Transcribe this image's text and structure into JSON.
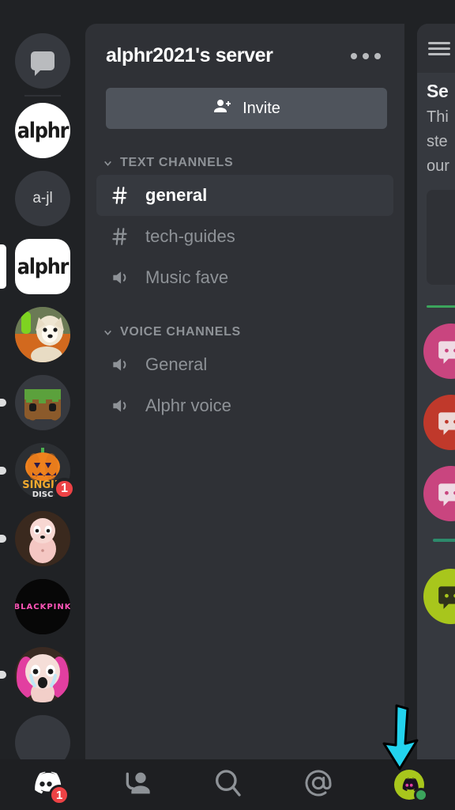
{
  "server_rail": {
    "items": [
      {
        "name": "direct-messages",
        "type": "dm-home",
        "label": "",
        "indicator": "none",
        "badge": ""
      },
      {
        "name": "server-alphr-circle",
        "type": "wordmark-circle",
        "label": "alphr",
        "indicator": "none",
        "badge": ""
      },
      {
        "name": "server-a-jl",
        "type": "text-circle",
        "label": "a-jl",
        "indicator": "none",
        "badge": ""
      },
      {
        "name": "server-alphr-active",
        "type": "wordmark-square",
        "label": "alphr",
        "indicator": "active",
        "badge": ""
      },
      {
        "name": "server-dog",
        "type": "art-dog",
        "label": "",
        "indicator": "none",
        "badge": ""
      },
      {
        "name": "server-minecraft",
        "type": "art-minecraft",
        "label": "",
        "indicator": "dot",
        "badge": ""
      },
      {
        "name": "server-singin-disc",
        "type": "art-pumpkin",
        "label": "SINGIN' DISC",
        "indicator": "dot",
        "badge": "1"
      },
      {
        "name": "server-isaac",
        "type": "art-isaac",
        "label": "",
        "indicator": "dot",
        "badge": ""
      },
      {
        "name": "server-blackpink",
        "type": "art-blackpink",
        "label": "BLACKPINK",
        "indicator": "none",
        "badge": ""
      },
      {
        "name": "server-isaac-crying",
        "type": "art-isaac-cry",
        "label": "",
        "indicator": "dot",
        "badge": ""
      },
      {
        "name": "add-server",
        "type": "add",
        "label": "",
        "indicator": "none",
        "badge": ""
      }
    ]
  },
  "panel": {
    "server_name": "alphr2021's server",
    "overflow_label": "More options",
    "invite_label": "Invite",
    "categories": [
      {
        "name": "TEXT CHANNELS",
        "channels": [
          {
            "label": "general",
            "icon": "hash-icon",
            "selected": true
          },
          {
            "label": "tech-guides",
            "icon": "hash-icon",
            "selected": false
          },
          {
            "label": "Music fave",
            "icon": "speaker-icon",
            "selected": false
          }
        ]
      },
      {
        "name": "VOICE CHANNELS",
        "channels": [
          {
            "label": "General",
            "icon": "speaker-icon",
            "selected": false
          },
          {
            "label": "Alphr voice",
            "icon": "speaker-icon",
            "selected": false
          }
        ]
      }
    ]
  },
  "content_peek": {
    "title": "Se",
    "line1": "Thi",
    "line2": "ste",
    "line3": "our",
    "avatar_colors": [
      "#c9457f",
      "#c0392b",
      "#c9457f",
      "#a8c61c"
    ]
  },
  "bottom_nav": {
    "items": [
      {
        "name": "nav-servers",
        "icon": "discord-logo-icon",
        "badge": "1"
      },
      {
        "name": "nav-friends",
        "icon": "friends-icon",
        "badge": ""
      },
      {
        "name": "nav-search",
        "icon": "search-icon",
        "badge": ""
      },
      {
        "name": "nav-mentions",
        "icon": "at-mention-icon",
        "badge": ""
      },
      {
        "name": "nav-profile",
        "icon": "user-avatar-icon",
        "badge": ""
      }
    ]
  },
  "annotation": {
    "arrow_color": "#22d3ee",
    "points_to": "nav-profile"
  },
  "colors": {
    "rail_bg": "#202225",
    "panel_bg": "#2f3136",
    "selected_bg": "#36393f",
    "invite_bg": "#4f545c",
    "badge_red": "#ed4245",
    "online_green": "#3ba55c",
    "text_muted": "#8e9297",
    "text_bright": "#ffffff"
  }
}
